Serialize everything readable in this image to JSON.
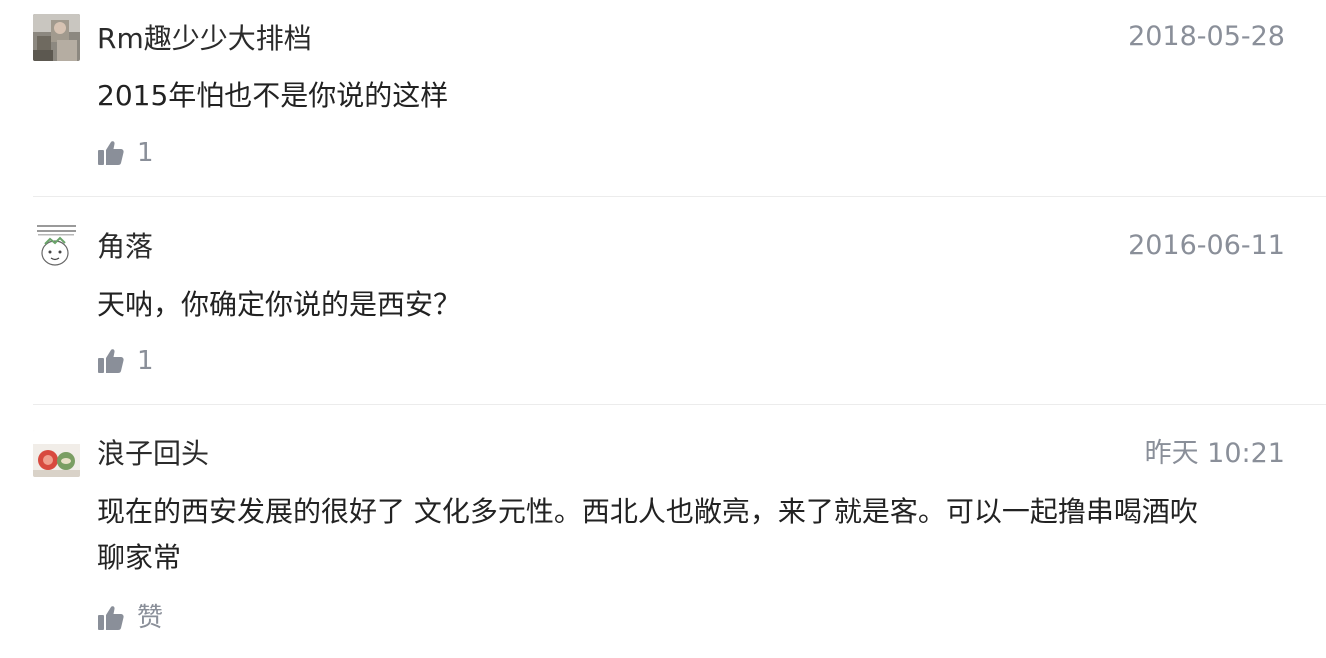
{
  "comments": [
    {
      "username": "Rm趣少少大排档",
      "date": "2018-05-28",
      "text": "2015年怕也不是你说的这样",
      "text_line2": "",
      "likes": "1",
      "like_icon": "thumbs-up-icon",
      "avatar": "photo-avatar"
    },
    {
      "username": "角落",
      "date": "2016-06-11",
      "text": "天呐，你确定你说的是西安？",
      "text_line2": "",
      "likes": "1",
      "like_icon": "thumbs-up-icon",
      "avatar": "cartoon-face-avatar"
    },
    {
      "username": "浪子回头",
      "date": "昨天 10:21",
      "text": "现在的西安发展的很好了 文化多元性。西北人也敞亮，来了就是客。可以一起撸串喝酒吹",
      "text_line2": "聊家常",
      "likes": "赞",
      "like_icon": "thumbs-up-icon",
      "avatar": "food-photo-avatar"
    }
  ],
  "colors": {
    "text": "#222222",
    "meta": "#8a8f99",
    "icon": "#8a8f99",
    "divider": "#ececec"
  }
}
